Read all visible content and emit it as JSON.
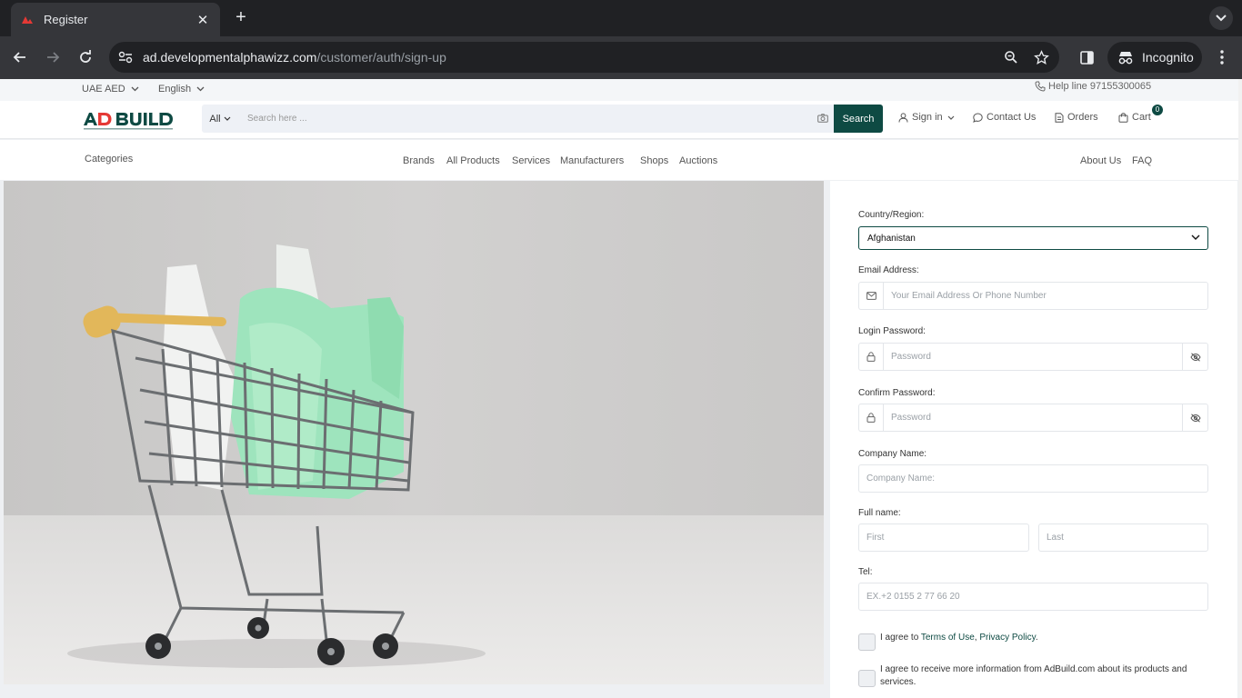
{
  "browser": {
    "tab_title": "Register",
    "url_host": "ad.developmentalphawizz.com",
    "url_path": "/customer/auth/sign-up",
    "incognito_label": "Incognito"
  },
  "topbar": {
    "currency": "UAE AED",
    "language": "English",
    "helpline": "Help line 97155300065"
  },
  "header": {
    "search_category": "All",
    "search_placeholder": "Search here ...",
    "search_button": "Search",
    "sign_in": "Sign in",
    "contact_us": "Contact Us",
    "orders": "Orders",
    "cart": "Cart",
    "cart_count": "0"
  },
  "nav": {
    "categories": "Categories",
    "items": [
      "Brands",
      "All Products",
      "Services",
      "Manufacturers",
      "Shops",
      "Auctions"
    ],
    "right_items": [
      "About Us",
      "FAQ"
    ]
  },
  "form": {
    "country_label": "Country/Region:",
    "country_value": "Afghanistan",
    "email_label": "Email Address:",
    "email_placeholder": "Your Email Address Or Phone Number",
    "password_label": "Login Password:",
    "password_placeholder": "Password",
    "confirm_label": "Confirm Password:",
    "confirm_placeholder": "Password",
    "company_label": "Company Name:",
    "company_placeholder": "Company Name:",
    "fullname_label": "Full name:",
    "first_placeholder": "First",
    "last_placeholder": "Last",
    "tel_label": "Tel:",
    "tel_placeholder": "EX.+2 0155 2 77 66 20",
    "agree_prefix": "I agree to ",
    "terms_link": "Terms of Use",
    "agree_sep": ", ",
    "privacy_link": "Privacy Policy",
    "agree_suffix": ".",
    "marketing_text": "I agree to receive more information from AdBuild.com about its products and services."
  },
  "colors": {
    "brand": "#0e4a43",
    "chrome_dark": "#202124",
    "chrome_mid": "#35363a"
  }
}
